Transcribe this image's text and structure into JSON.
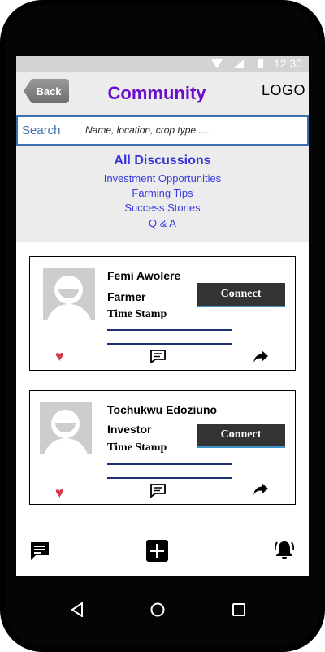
{
  "status_bar": {
    "time": "12:30"
  },
  "header": {
    "back_label": "Back",
    "title": "Community",
    "logo_text": "LOGO"
  },
  "search": {
    "label": "Search",
    "placeholder": "Name, location, crop type ...."
  },
  "categories": {
    "main": "All Discussions",
    "items": [
      "Investment Opportunities",
      "Farming Tips",
      "Success Stories",
      "Q & A"
    ]
  },
  "posts": [
    {
      "name": "Femi Awolere",
      "role": "Farmer",
      "timestamp_label": "Time Stamp",
      "connect_label": "Connect"
    },
    {
      "name": "Tochukwu Edoziuno",
      "role": "Investor",
      "timestamp_label": "Time Stamp",
      "connect_label": "Connect"
    }
  ],
  "icons": {
    "like": "heart-icon",
    "comment": "comment-icon",
    "share": "share-icon",
    "nav_messages": "message-icon",
    "nav_add": "add-icon",
    "nav_alerts": "bell-icon",
    "system_back": "triangle-back-icon",
    "system_home": "circle-home-icon",
    "system_recents": "square-recents-icon"
  },
  "colors": {
    "title": "#6a0dcc",
    "links": "#3b3be0",
    "heart": "#d6384c",
    "connect_bg": "#333333"
  }
}
